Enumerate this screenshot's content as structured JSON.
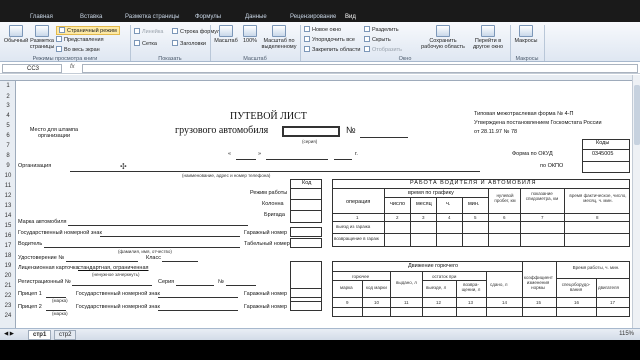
{
  "ribbon": {
    "tabs": [
      "Главная",
      "Вставка",
      "Разметка страницы",
      "Формулы",
      "Данные",
      "Рецензирование",
      "Вид"
    ],
    "view_modes": {
      "normal": "Обычный",
      "page_layout": "Разметка страницы",
      "page_break": "Страничный режим",
      "custom_views": "Представления",
      "fullscreen": "Во весь экран",
      "group_label": "Режимы просмотра книги"
    },
    "show": {
      "ruler": "Линейка",
      "grid": "Сетка",
      "formula_bar": "Строка формул",
      "headings": "Заголовки",
      "group_label": "Показать"
    },
    "zoom": {
      "zoom": "Масштаб",
      "hundred": "100%",
      "selection": "Масштаб по выделенному",
      "group_label": "Масштаб"
    },
    "window": {
      "new_window": "Новое окно",
      "arrange_all": "Упорядочить все",
      "freeze_panes": "Закрепить области",
      "split": "Разделить",
      "hide": "Скрыть",
      "unhide": "Отобразить",
      "save_workspace": "Сохранить рабочую область",
      "switch_windows": "Перейти в другое окно",
      "group_label": "Окно"
    },
    "macros": {
      "macros": "Макросы",
      "group_label": "Макросы"
    }
  },
  "formula_bar": {
    "cell_ref": "CC3",
    "fx": "fx",
    "value": ""
  },
  "row_numbers": [
    "1",
    "2",
    "3",
    "4",
    "5",
    "6",
    "7",
    "8",
    "9",
    "10",
    "11",
    "12",
    "13",
    "14",
    "15",
    "16",
    "17",
    "18",
    "19",
    "20",
    "21",
    "22",
    "23",
    "24"
  ],
  "form": {
    "title": "ПУТЕВОЙ ЛИСТ",
    "subtitle": "грузового автомобиля",
    "number_sign": "№",
    "series": "(серия)",
    "stamp_place": "Место для штампа организации",
    "date_quote_open": "«",
    "date_quote_close": "»",
    "year_suffix": "г.",
    "codes": "Коды",
    "okud_label": "Форма по ОКУД",
    "okud_value": "0345005",
    "okpo_label": "по ОКПО",
    "typical_form": "Типовая межотраслевая форма № 4-П",
    "approved": "Утверждена постановлением Госкомстата России",
    "approved_date": "от 28.11.97 № 78",
    "organization": "Организация",
    "org_hint": "(наименование, адрес и номер телефона)",
    "code_col": "Код",
    "work_mode": "Режим работы",
    "column": "Колонна",
    "brigade": "Бригада",
    "car_brand": "Марка автомобиля",
    "reg_plate": "Государственный номерной знак",
    "garage_no": "Гаражный номер",
    "driver": "Водитель",
    "driver_hint": "(фамилия, имя, отчество)",
    "tab_no": "Табельный номер",
    "license": "Удостоверение №",
    "class": "Класс",
    "license_card": "Лицензионная карточка",
    "license_card_value": "стандартная, ограниченная",
    "license_hint": "(ненужное зачеркнуть)",
    "reg_no": "Регистрационный №",
    "series_label": "Серия",
    "no_label": "№",
    "trailer1": "Прицеп 1",
    "trailer2": "Прицеп 2",
    "brand_hint": "(марка)",
    "driver_work": "РАБОТА ВОДИТЕЛЯ И АВТОМОБИЛЯ",
    "operation": "операция",
    "schedule_time": "время по графику",
    "day": "число",
    "month": "месяц",
    "hours": "ч.",
    "minutes": "мин.",
    "zero_run": "нулевой пробег, км",
    "odometer": "показание спидометра, км",
    "actual_time": "время фактическое, число, месяц, ч. мин.",
    "garage_out": "выезд из гаража",
    "garage_return": "возвращение в гараж",
    "col_nums_1": [
      "1",
      "2",
      "3",
      "4",
      "5",
      "6",
      "7",
      "8"
    ],
    "fuel_move": "Движение горючего",
    "fuel": "горючее",
    "brand": "марка",
    "code": "код марки",
    "issued": "выдано, л",
    "remain": "остаток при",
    "out": "выезде, л",
    "returned": "возвра-щении, л",
    "handed": "сдано, л",
    "coef": "коэффициент изменения нормы",
    "time_equip": "Время работы, ч. мин.",
    "spec": "спецоборудо-вания",
    "engine": "двигателя",
    "col_nums_2": [
      "9",
      "10",
      "11",
      "12",
      "13",
      "14",
      "15",
      "16",
      "17"
    ]
  },
  "sheets": [
    "стр1",
    "стр2"
  ],
  "zoom_level": "115%"
}
